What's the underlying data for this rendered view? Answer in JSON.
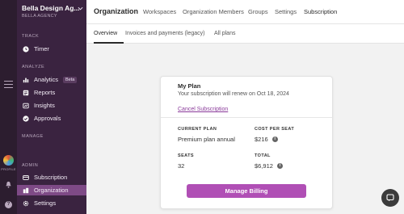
{
  "rail": {
    "profile_label": "PROFILE"
  },
  "workspace": {
    "name": "Bella Design Ag...",
    "subtitle": "BELLA AGENCY"
  },
  "sidebar": {
    "sections": [
      {
        "label": "TRACK"
      },
      {
        "label": "ANALYZE"
      },
      {
        "label": "MANAGE"
      },
      {
        "label": "ADMIN"
      }
    ],
    "items": [
      {
        "label": "Timer",
        "icon": "clock-icon"
      },
      {
        "label": "Analytics",
        "icon": "bar-chart-icon",
        "badge": "Beta"
      },
      {
        "label": "Reports",
        "icon": "report-icon"
      },
      {
        "label": "Insights",
        "icon": "insights-icon"
      },
      {
        "label": "Approvals",
        "icon": "check-circle-icon"
      },
      {
        "label": "Subscription",
        "icon": "card-icon"
      },
      {
        "label": "Organization",
        "icon": "building-icon",
        "active": true
      },
      {
        "label": "Settings",
        "icon": "gear-icon"
      }
    ]
  },
  "header": {
    "title": "Organization",
    "tabs": [
      "Workspaces",
      "Organization Members",
      "Groups",
      "Settings",
      "Subscription"
    ]
  },
  "subtabs": [
    "Overview",
    "Invoices and payments (legacy)",
    "All plans"
  ],
  "card": {
    "title": "My Plan",
    "renewal": "Your subscription will renew on Oct 18, 2024",
    "cancel_label": "Cancel Subscription",
    "current_plan_label": "CURRENT PLAN",
    "current_plan_value": "Premium plan annual",
    "cost_label": "COST PER SEAT",
    "cost_value": "$216",
    "seats_label": "SEATS",
    "seats_value": "32",
    "total_label": "TOTAL",
    "total_value": "$6,912",
    "manage_label": "Manage Billing"
  },
  "colors": {
    "sidebar": "#3a2340",
    "accent": "#b04fb5",
    "active_item": "#7e4a86"
  }
}
